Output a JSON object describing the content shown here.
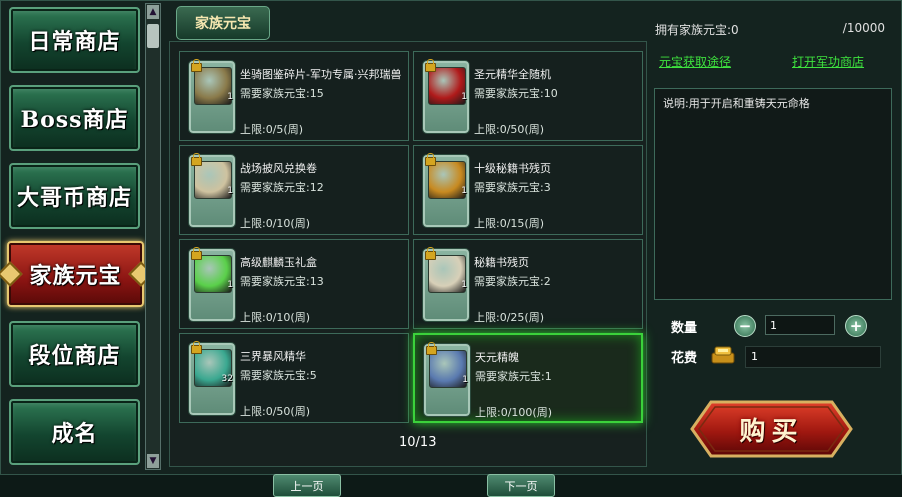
{
  "menu": [
    {
      "label": "日常商店",
      "active": false
    },
    {
      "label": "Boss商店",
      "active": false
    },
    {
      "label": "大哥币商店",
      "active": false
    },
    {
      "label": "家族元宝",
      "active": true
    },
    {
      "label": "段位商店",
      "active": false
    },
    {
      "label": "成名",
      "active": false
    }
  ],
  "tab_title": "家族元宝",
  "items": [
    {
      "name": "坐骑图鉴碎片-军功专属·兴邦瑞兽",
      "price": "需要家族元宝:15",
      "limit": "上限:0/5(周)",
      "qty": "1",
      "icon": "mount-fragment-icon",
      "color": "#8a7a4a"
    },
    {
      "name": "圣元精华全随机",
      "price": "需要家族元宝:10",
      "limit": "上限:0/50(周)",
      "qty": "1",
      "icon": "gift-box-icon",
      "color": "#b01a1a"
    },
    {
      "name": "战场披风兑换卷",
      "price": "需要家族元宝:12",
      "limit": "上限:0/10(周)",
      "qty": "1",
      "icon": "scroll-icon",
      "color": "#cfc3a0"
    },
    {
      "name": "十级秘籍书残页",
      "price": "需要家族元宝:3",
      "limit": "上限:0/15(周)",
      "qty": "1",
      "icon": "book-icon",
      "color": "#c88a20"
    },
    {
      "name": "高级麒麟玉礼盒",
      "price": "需要家族元宝:13",
      "limit": "上限:0/10(周)",
      "qty": "1",
      "icon": "green-orb-icon",
      "color": "#5ad04a"
    },
    {
      "name": "秘籍书残页",
      "price": "需要家族元宝:2",
      "limit": "上限:0/25(周)",
      "qty": "1",
      "icon": "page-icon",
      "color": "#d8d0b8"
    },
    {
      "name": "三界暴风精华",
      "price": "需要家族元宝:5",
      "limit": "上限:0/50(周)",
      "qty": "32",
      "icon": "green-gem-icon",
      "color": "#3aa890"
    },
    {
      "name": "天元精魄",
      "price": "需要家族元宝:1",
      "limit": "上限:0/100(周)",
      "qty": "1",
      "icon": "crystal-icon",
      "color": "#5a7ab0"
    }
  ],
  "selected_index": 7,
  "pager": {
    "prev": "上一页",
    "next": "下一页",
    "page": "10/13"
  },
  "right": {
    "owned_label": "拥有家族元宝:0",
    "owned_max": "/10000",
    "link_obtain": "元宝获取途径",
    "link_military": "打开军功商店",
    "description": "说明:用于开启和重铸天元命格",
    "qty_label": "数量",
    "qty_value": "1",
    "minus": "−",
    "plus": "+",
    "cost_label": "花费",
    "cost_value": "1",
    "buy_label": "购买"
  },
  "colors": {
    "accent_green": "#3ee23e",
    "selected_border": "#3bd23b",
    "active_tab": "#8a1412"
  }
}
